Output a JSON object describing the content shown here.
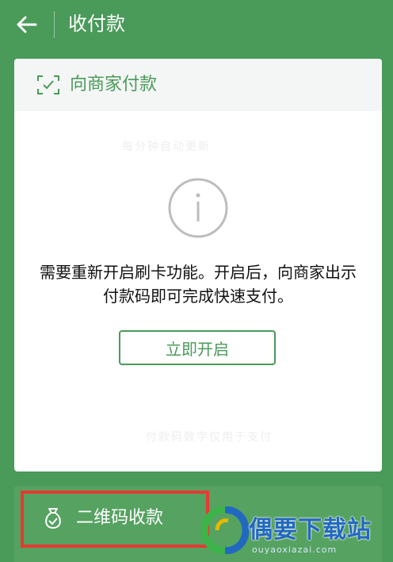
{
  "header": {
    "title": "收付款",
    "back_icon": "arrow-left-icon"
  },
  "pay_card": {
    "header_label": "向商家付款",
    "header_icon": "scan-check-icon",
    "faint_top": "每分钟自动更新",
    "message": "需要重新开启刷卡功能。开启后，向商家出示付款码即可完成快速支付。",
    "button_label": "立即开启",
    "faint_bottom": "付款码数字仅用于支付",
    "info_icon": "info-circle-icon"
  },
  "receive": {
    "label": "二维码收款",
    "icon": "money-bag-icon"
  },
  "watermark": {
    "text": "偶要下载站",
    "url": "ouyaoxiazai.com"
  },
  "colors": {
    "brand_green": "#4a9a5a",
    "highlight_red": "#e53a32",
    "watermark_blue": "#2268c0"
  }
}
